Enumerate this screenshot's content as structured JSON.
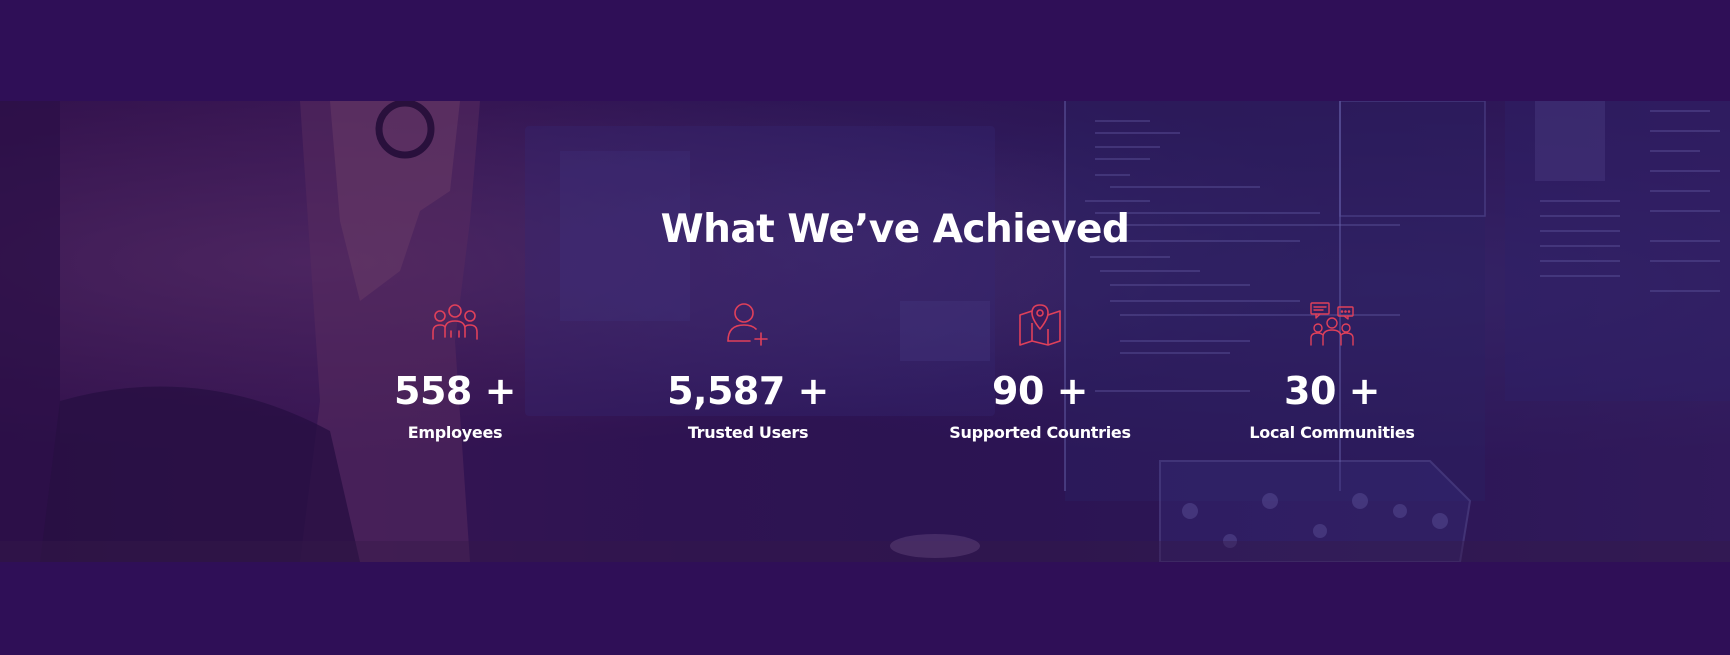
{
  "section": {
    "title": "What We’ve Achieved"
  },
  "stats": [
    {
      "value": "558 +",
      "label": "Employees",
      "icon": "people-group-icon"
    },
    {
      "value": "5,587 +",
      "label": "Trusted Users",
      "icon": "add-user-icon"
    },
    {
      "value": "90 +",
      "label": "Supported Countries",
      "icon": "map-pin-icon"
    },
    {
      "value": "30 +",
      "label": "Local Communities",
      "icon": "community-chat-icon"
    }
  ],
  "colors": {
    "page_background": "#2f0f57",
    "icon_accent": "#e0405a",
    "text": "#ffffff"
  }
}
